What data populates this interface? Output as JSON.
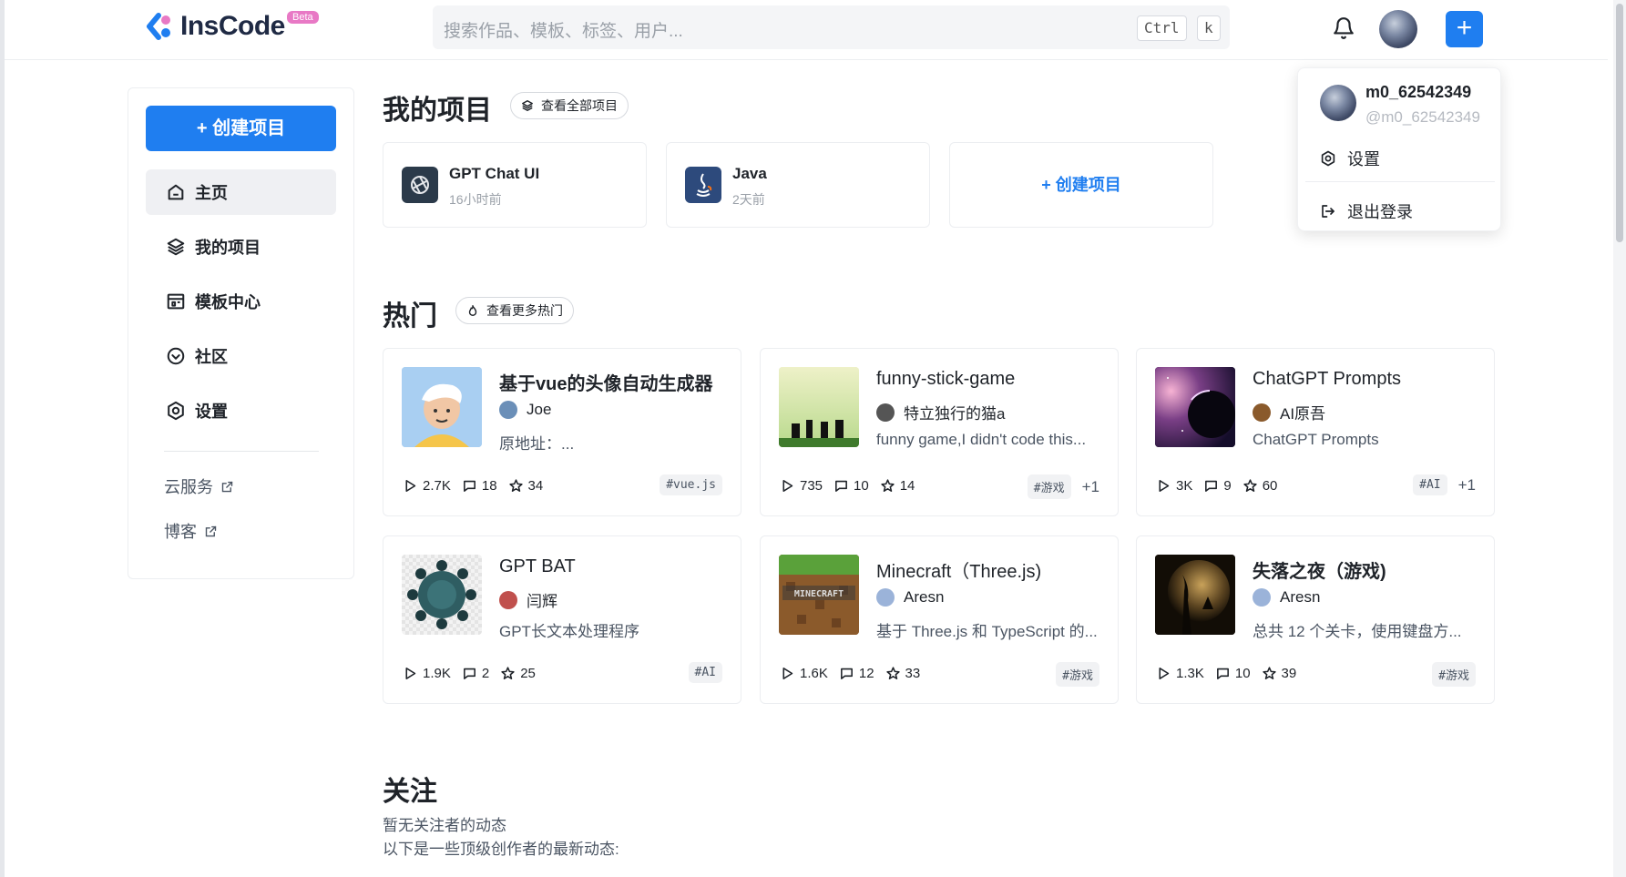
{
  "header": {
    "brand": "InsCode",
    "beta": "Beta",
    "search_placeholder": "搜索作品、模板、标签、用户...",
    "kbd_ctrl": "Ctrl",
    "kbd_k": "k",
    "plus": "+"
  },
  "sidebar": {
    "create_label": "+ 创建项目",
    "nav": [
      {
        "label": "主页",
        "icon": "home-icon",
        "active": true
      },
      {
        "label": "我的项目",
        "icon": "layers-icon",
        "active": false
      },
      {
        "label": "模板中心",
        "icon": "template-icon",
        "active": false
      },
      {
        "label": "社区",
        "icon": "community-icon",
        "active": false
      },
      {
        "label": "设置",
        "icon": "settings-icon",
        "active": false
      }
    ],
    "links": [
      {
        "label": "云服务",
        "icon": "external-link-icon"
      },
      {
        "label": "博客",
        "icon": "external-link-icon"
      }
    ]
  },
  "my_projects": {
    "title": "我的项目",
    "view_all": "查看全部项目",
    "items": [
      {
        "name": "GPT Chat UI",
        "time": "16小时前"
      },
      {
        "name": "Java",
        "time": "2天前"
      }
    ],
    "create_label": "+ 创建项目"
  },
  "hot": {
    "title": "热门",
    "view_more": "查看更多热门",
    "cards": [
      {
        "title": "基于vue的头像自动生成器",
        "author": "Joe",
        "desc": "原地址：...",
        "plays": "2.7K",
        "comments": "18",
        "stars": "34",
        "tag": "#vue.js",
        "more": ""
      },
      {
        "title": "funny-stick-game",
        "author": "特立独行的猫a",
        "desc": "funny game,I didn't code this...",
        "plays": "735",
        "comments": "10",
        "stars": "14",
        "tag": "#游戏",
        "more": "+1"
      },
      {
        "title": "ChatGPT Prompts",
        "author": "AI原吾",
        "desc": "ChatGPT Prompts",
        "plays": "3K",
        "comments": "9",
        "stars": "60",
        "tag": "#AI",
        "more": "+1"
      },
      {
        "title": "GPT BAT",
        "author": "闫辉",
        "desc": "GPT长文本处理程序",
        "plays": "1.9K",
        "comments": "2",
        "stars": "25",
        "tag": "#AI",
        "more": ""
      },
      {
        "title": "Minecraft（Three.js)",
        "author": "Aresn",
        "desc": "基于 Three.js 和 TypeScript 的...",
        "plays": "1.6K",
        "comments": "12",
        "stars": "33",
        "tag": "#游戏",
        "more": ""
      },
      {
        "title": "失落之夜（游戏)",
        "author": "Aresn",
        "desc": "总共 12 个关卡，使用键盘方...",
        "plays": "1.3K",
        "comments": "10",
        "stars": "39",
        "tag": "#游戏",
        "more": ""
      }
    ]
  },
  "follow": {
    "title": "关注",
    "line1": "暂无关注者的动态",
    "line2": "以下是一些顶级创作者的最新动态:"
  },
  "dropdown": {
    "username": "m0_62542349",
    "handle": "@m0_62542349",
    "settings": "设置",
    "logout": "退出登录"
  },
  "colors": {
    "accent": "#1f7ef0",
    "beta": "#e879c5"
  }
}
